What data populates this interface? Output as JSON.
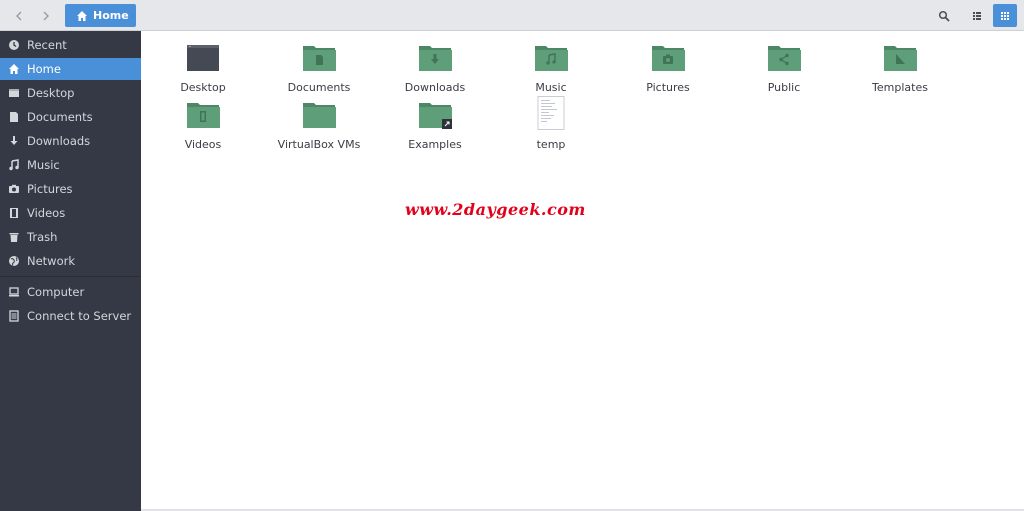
{
  "header": {
    "breadcrumb_home": "Home",
    "accent": "#4a90d9"
  },
  "sidebar": {
    "items": [
      {
        "label": "Recent",
        "icon": "clock-icon"
      },
      {
        "label": "Home",
        "icon": "home-icon",
        "active": true
      },
      {
        "label": "Desktop",
        "icon": "desktop-icon"
      },
      {
        "label": "Documents",
        "icon": "document-icon"
      },
      {
        "label": "Downloads",
        "icon": "download-icon"
      },
      {
        "label": "Music",
        "icon": "music-icon"
      },
      {
        "label": "Pictures",
        "icon": "camera-icon"
      },
      {
        "label": "Videos",
        "icon": "film-icon"
      },
      {
        "label": "Trash",
        "icon": "trash-icon"
      },
      {
        "label": "Network",
        "icon": "globe-icon"
      },
      {
        "label": "Computer",
        "icon": "computer-icon"
      },
      {
        "label": "Connect to Server",
        "icon": "server-icon"
      }
    ]
  },
  "files": [
    {
      "name": "Desktop",
      "type": "desktop-folder-icon"
    },
    {
      "name": "Documents",
      "type": "documents-folder-icon"
    },
    {
      "name": "Downloads",
      "type": "downloads-folder-icon"
    },
    {
      "name": "Music",
      "type": "music-folder-icon"
    },
    {
      "name": "Pictures",
      "type": "pictures-folder-icon"
    },
    {
      "name": "Public",
      "type": "public-folder-icon"
    },
    {
      "name": "Templates",
      "type": "templates-folder-icon"
    },
    {
      "name": "Videos",
      "type": "videos-folder-icon"
    },
    {
      "name": "VirtualBox VMs",
      "type": "folder-icon"
    },
    {
      "name": "Examples",
      "type": "symlink-folder-icon"
    },
    {
      "name": "temp",
      "type": "text-file-icon"
    }
  ],
  "watermark": "www.2daygeek.com",
  "colors": {
    "folder": "#5e9e79",
    "folder_tab": "#4d8766",
    "sidebar_bg": "#353945"
  }
}
